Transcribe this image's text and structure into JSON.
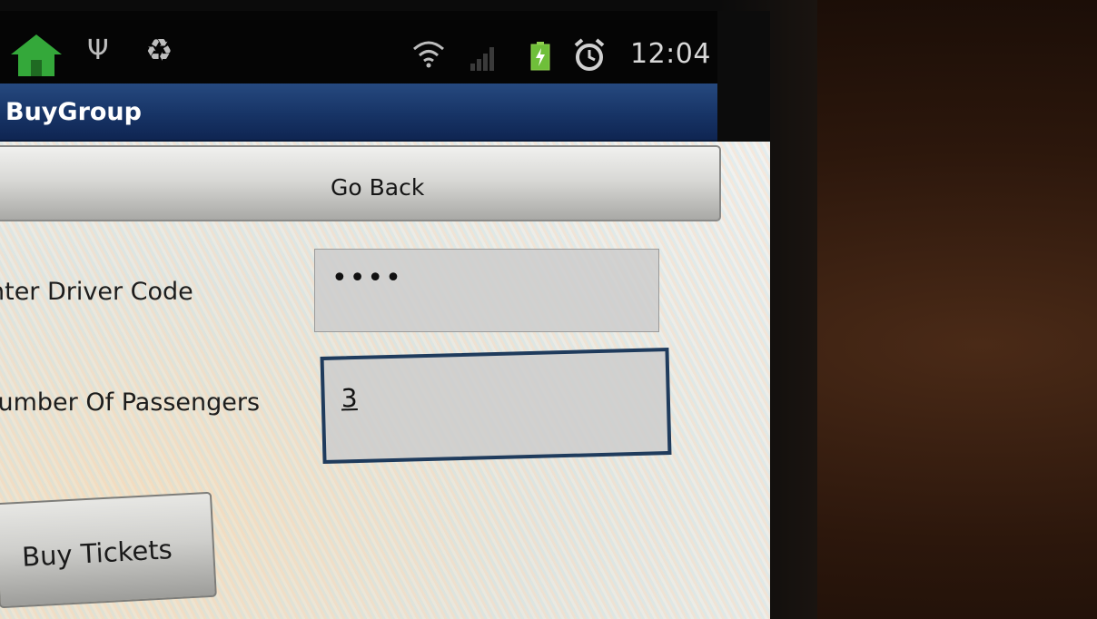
{
  "status_bar": {
    "time": "12:04",
    "icons": [
      "home-icon",
      "usb-icon",
      "recycle-icon",
      "wifi-icon",
      "signal-icon",
      "battery-charging-icon",
      "alarm-icon"
    ]
  },
  "app": {
    "title": "BuyGroup"
  },
  "buttons": {
    "go_back": "Go Back",
    "buy_tickets": "Buy Tickets"
  },
  "form": {
    "driver_code_label": "nter Driver Code",
    "driver_code_value": "••••",
    "passengers_label": "lumber Of Passengers",
    "passengers_value": "3"
  },
  "colors": {
    "title_bar": "#173466",
    "focused_field_border": "#1f3b5c",
    "home_icon": "#34a83a"
  }
}
